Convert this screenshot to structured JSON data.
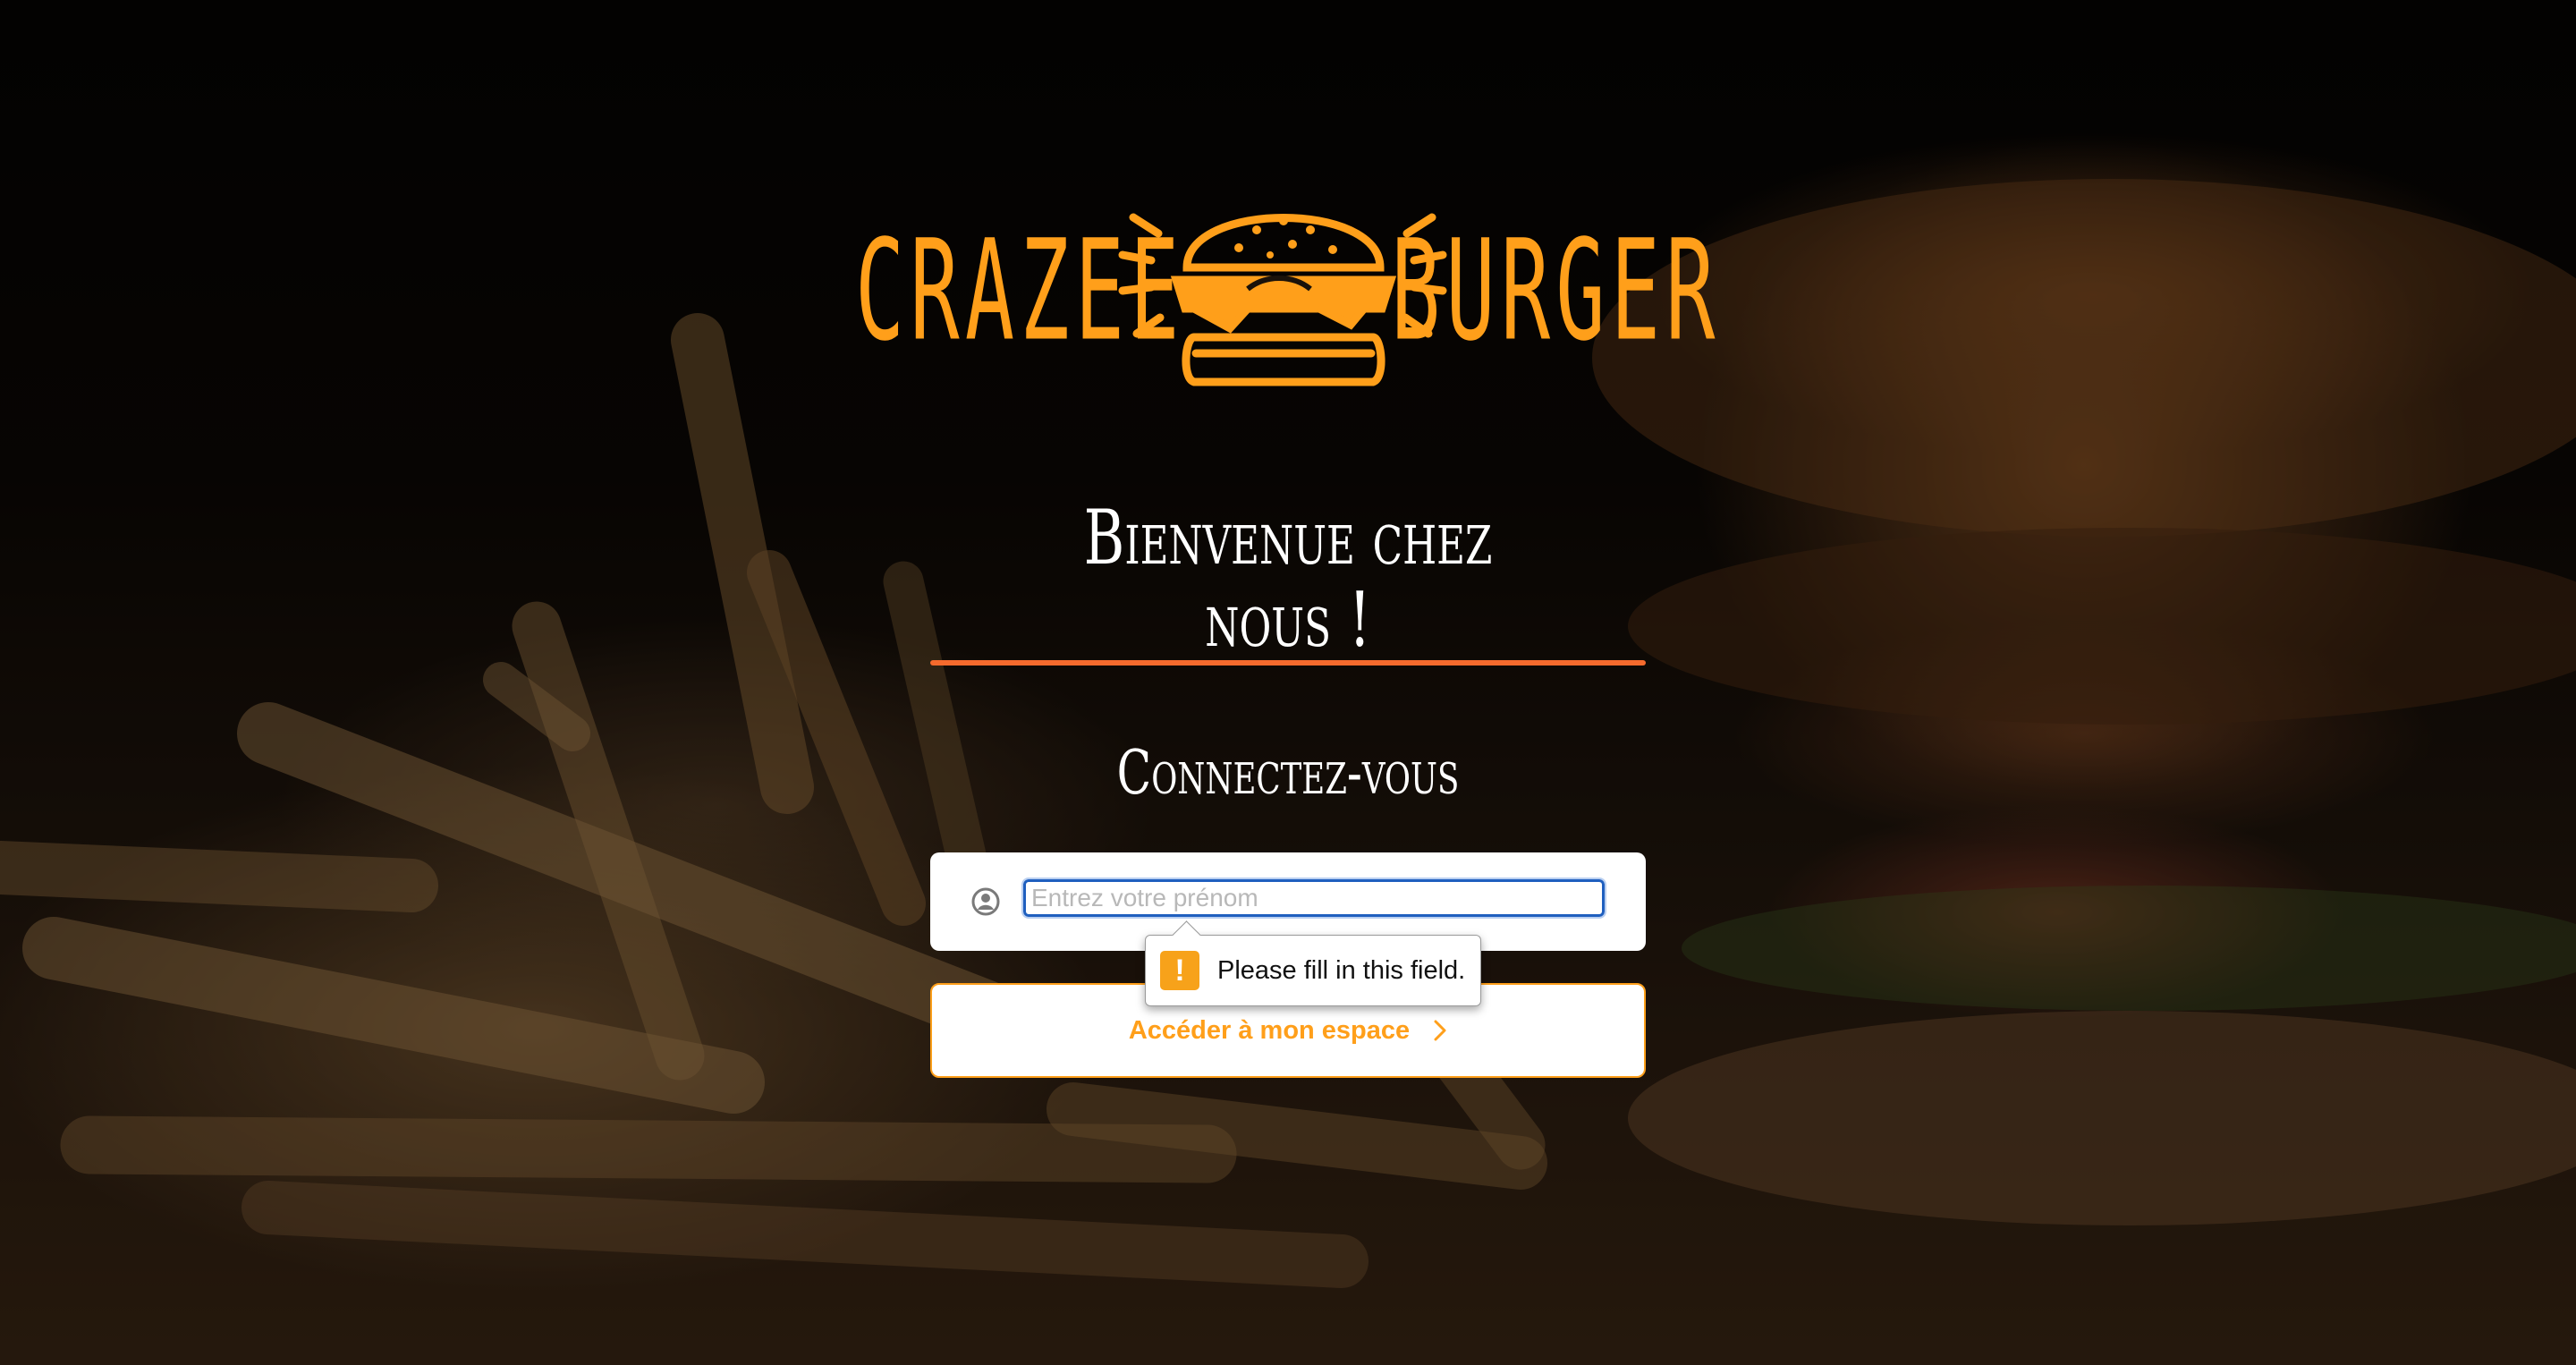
{
  "brand": {
    "left_word": "CRAZEE",
    "right_word": "BURGER",
    "color": "#ff9f1a",
    "icon": "burger-icon"
  },
  "welcome": {
    "title": "Bienvenue chez nous !",
    "divider_color": "#f56a2d"
  },
  "login": {
    "heading": "Connectez-vous",
    "input": {
      "placeholder": "Entrez votre prénom",
      "value": "",
      "icon": "user-circle-icon"
    },
    "validation": {
      "message": "Please fill in this field.",
      "icon": "warning-icon",
      "icon_color": "#f7a21a"
    },
    "submit": {
      "label": "Accéder à mon espace",
      "icon": "chevron-right-icon"
    }
  }
}
